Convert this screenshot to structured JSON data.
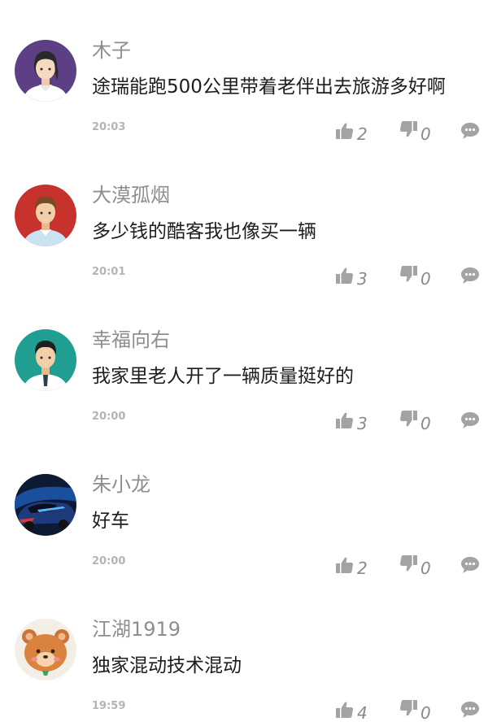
{
  "comments": [
    {
      "username": "木子",
      "content": "途瑞能跑500公里带着老伴出去旅游多好啊",
      "time": "20:03",
      "likes": "2",
      "dislikes": "0",
      "avatar": "woman-avatar"
    },
    {
      "username": "大漠孤烟",
      "content": "多少钱的酷客我也像买一辆",
      "time": "20:01",
      "likes": "3",
      "dislikes": "0",
      "avatar": "man-avatar-red"
    },
    {
      "username": "幸福向右",
      "content": "我家里老人开了一辆质量挺好的",
      "time": "20:00",
      "likes": "3",
      "dislikes": "0",
      "avatar": "man-avatar-teal"
    },
    {
      "username": "朱小龙",
      "content": "好车",
      "time": "20:00",
      "likes": "2",
      "dislikes": "0",
      "avatar": "car-photo-avatar"
    },
    {
      "username": "江湖1919",
      "content": "独家混动技术混动",
      "time": "19:59",
      "likes": "4",
      "dislikes": "0",
      "avatar": "bear-avatar"
    }
  ],
  "icons": {
    "like": "thumbs-up-icon",
    "dislike": "thumbs-down-icon",
    "reply": "speech-bubble-icon"
  },
  "colors": {
    "icon_gray": "#a3a3a3",
    "username_gray": "#8e8e8e",
    "content_black": "#1d1d1d",
    "time_gray": "#b4b4b4"
  }
}
